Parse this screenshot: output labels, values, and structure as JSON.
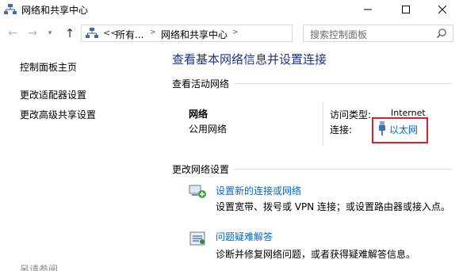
{
  "window": {
    "title": "网络和共享中心"
  },
  "address": {
    "overflow": "<<",
    "crumbs": [
      "所有...",
      "网络和共享中心"
    ],
    "search_placeholder": "搜索控制面板"
  },
  "sidebar": {
    "items": [
      {
        "label": "控制面板主页"
      },
      {
        "label": "更改适配器设置"
      },
      {
        "label": "更改高级共享设置"
      }
    ],
    "see_also": "另请参阅"
  },
  "main": {
    "title": "查看基本网络信息并设置连接",
    "active_networks_label": "查看活动网络",
    "network": {
      "name": "网络",
      "type": "公用网络",
      "access_type_label": "访问类型:",
      "access_type_value": "Internet",
      "connections_label": "连接:",
      "connection_link": "以太网"
    },
    "change_settings_label": "更改网络设置",
    "tasks": [
      {
        "icon": "new-connection-icon",
        "link": "设置新的连接或网络",
        "desc": "设置宽带、拨号或 VPN 连接；或设置路由器或接入点。"
      },
      {
        "icon": "troubleshoot-icon",
        "link": "问题疑难解答",
        "desc": "诊断并修复网络问题，或者获得疑难解答信息。"
      }
    ]
  },
  "colors": {
    "title_blue": "#1e3287",
    "link_blue": "#0066cc",
    "highlight_red": "#d2232a"
  }
}
